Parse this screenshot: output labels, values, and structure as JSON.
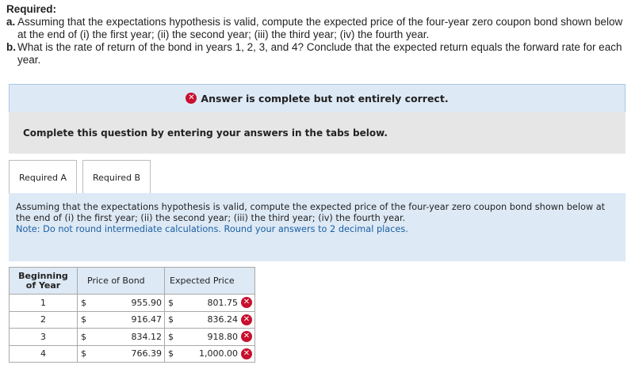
{
  "required": {
    "title": "Required:",
    "items": [
      {
        "label": "a.",
        "text": "Assuming that the expectations hypothesis is valid, compute the expected price of the four-year zero coupon bond shown below at the end of (i) the first year; (ii) the second year; (iii) the third year; (iv) the fourth year."
      },
      {
        "label": "b.",
        "text": "What is the rate of return of the bond in years 1, 2, 3, and 4? Conclude that the expected return equals the forward rate for each year."
      }
    ]
  },
  "banner": {
    "icon": "x-circle-icon",
    "text": "Answer is complete but not entirely correct."
  },
  "complete_text": "Complete this question by entering your answers in the tabs below.",
  "tabs": [
    {
      "label": "Required A"
    },
    {
      "label": "Required B"
    }
  ],
  "panel": {
    "instruction": "Assuming that the expectations hypothesis is valid, compute the expected price of the four-year zero coupon bond shown below at the end of (i) the first year; (ii) the second year; (iii) the third year; (iv) the fourth year.",
    "note": "Note: Do not round intermediate calculations. Round your answers to 2 decimal places."
  },
  "table": {
    "headers": {
      "year": "Beginning of Year",
      "price": "Price of Bond",
      "expected": "Expected Price"
    },
    "currency": "$",
    "rows": [
      {
        "year": "1",
        "price": "955.90",
        "expected": "801.75",
        "status": "incorrect"
      },
      {
        "year": "2",
        "price": "916.47",
        "expected": "836.24",
        "status": "incorrect"
      },
      {
        "year": "3",
        "price": "834.12",
        "expected": "918.80",
        "status": "incorrect"
      },
      {
        "year": "4",
        "price": "766.39",
        "expected": "1,000.00",
        "status": "incorrect"
      }
    ]
  },
  "colors": {
    "incorrect": "#c8102e",
    "panel_bg": "#dde9f5",
    "note": "#1b5fa3"
  }
}
